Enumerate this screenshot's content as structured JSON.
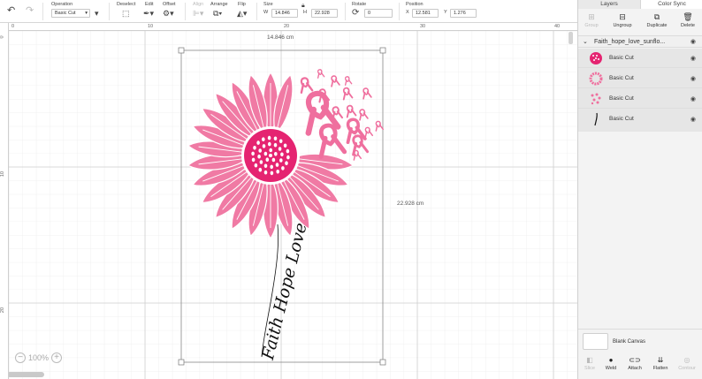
{
  "toolbar": {
    "operation": {
      "label": "Operation",
      "value": "Basic Cut",
      "chevron": "▾"
    },
    "deselect": {
      "label": "Deselect"
    },
    "edit": {
      "label": "Edit"
    },
    "offset": {
      "label": "Offset"
    },
    "align": {
      "label": "Align"
    },
    "arrange": {
      "label": "Arrange"
    },
    "flip": {
      "label": "Flip"
    },
    "size": {
      "label": "Size",
      "w_label": "W",
      "w_value": "14.846",
      "h_label": "H",
      "h_value": "22.928"
    },
    "rotate": {
      "label": "Rotate",
      "value": "0"
    },
    "position": {
      "label": "Position",
      "x_label": "X",
      "x_value": "12.581",
      "y_label": "Y",
      "y_value": "1.276"
    }
  },
  "ruler": {
    "h": [
      "0",
      "10",
      "20",
      "30",
      "40"
    ],
    "v": [
      "0",
      "10",
      "20"
    ]
  },
  "canvas": {
    "width_label": "14.846 cm",
    "height_label": "22.928 cm",
    "design_text": "Faith Hope Love",
    "zoom": "100%",
    "colors": {
      "petal": "#f07aa4",
      "center": "#e52471",
      "ribbon": "#ef6f9e",
      "text": "#111111"
    }
  },
  "panel": {
    "tabs": [
      "Layers",
      "Color Sync"
    ],
    "actions": [
      {
        "label": "Group",
        "icon": "group-icon",
        "enabled": false
      },
      {
        "label": "Ungroup",
        "icon": "ungroup-icon",
        "enabled": true
      },
      {
        "label": "Duplicate",
        "icon": "duplicate-icon",
        "enabled": true
      },
      {
        "label": "Delete",
        "icon": "delete-icon",
        "enabled": true
      }
    ],
    "group_name": "Faith_hope_love_sunflo...",
    "layers": [
      {
        "name": "Basic Cut",
        "thumb": "center"
      },
      {
        "name": "Basic Cut",
        "thumb": "petals"
      },
      {
        "name": "Basic Cut",
        "thumb": "ribbons"
      },
      {
        "name": "Basic Cut",
        "thumb": "text"
      }
    ],
    "blank_canvas": "Blank Canvas",
    "bottom_actions": [
      {
        "label": "Slice",
        "icon": "slice-icon",
        "enabled": false
      },
      {
        "label": "Weld",
        "icon": "weld-icon",
        "enabled": true
      },
      {
        "label": "Attach",
        "icon": "attach-icon",
        "enabled": true
      },
      {
        "label": "Flatten",
        "icon": "flatten-icon",
        "enabled": true
      },
      {
        "label": "Contour",
        "icon": "contour-icon",
        "enabled": false
      }
    ]
  }
}
